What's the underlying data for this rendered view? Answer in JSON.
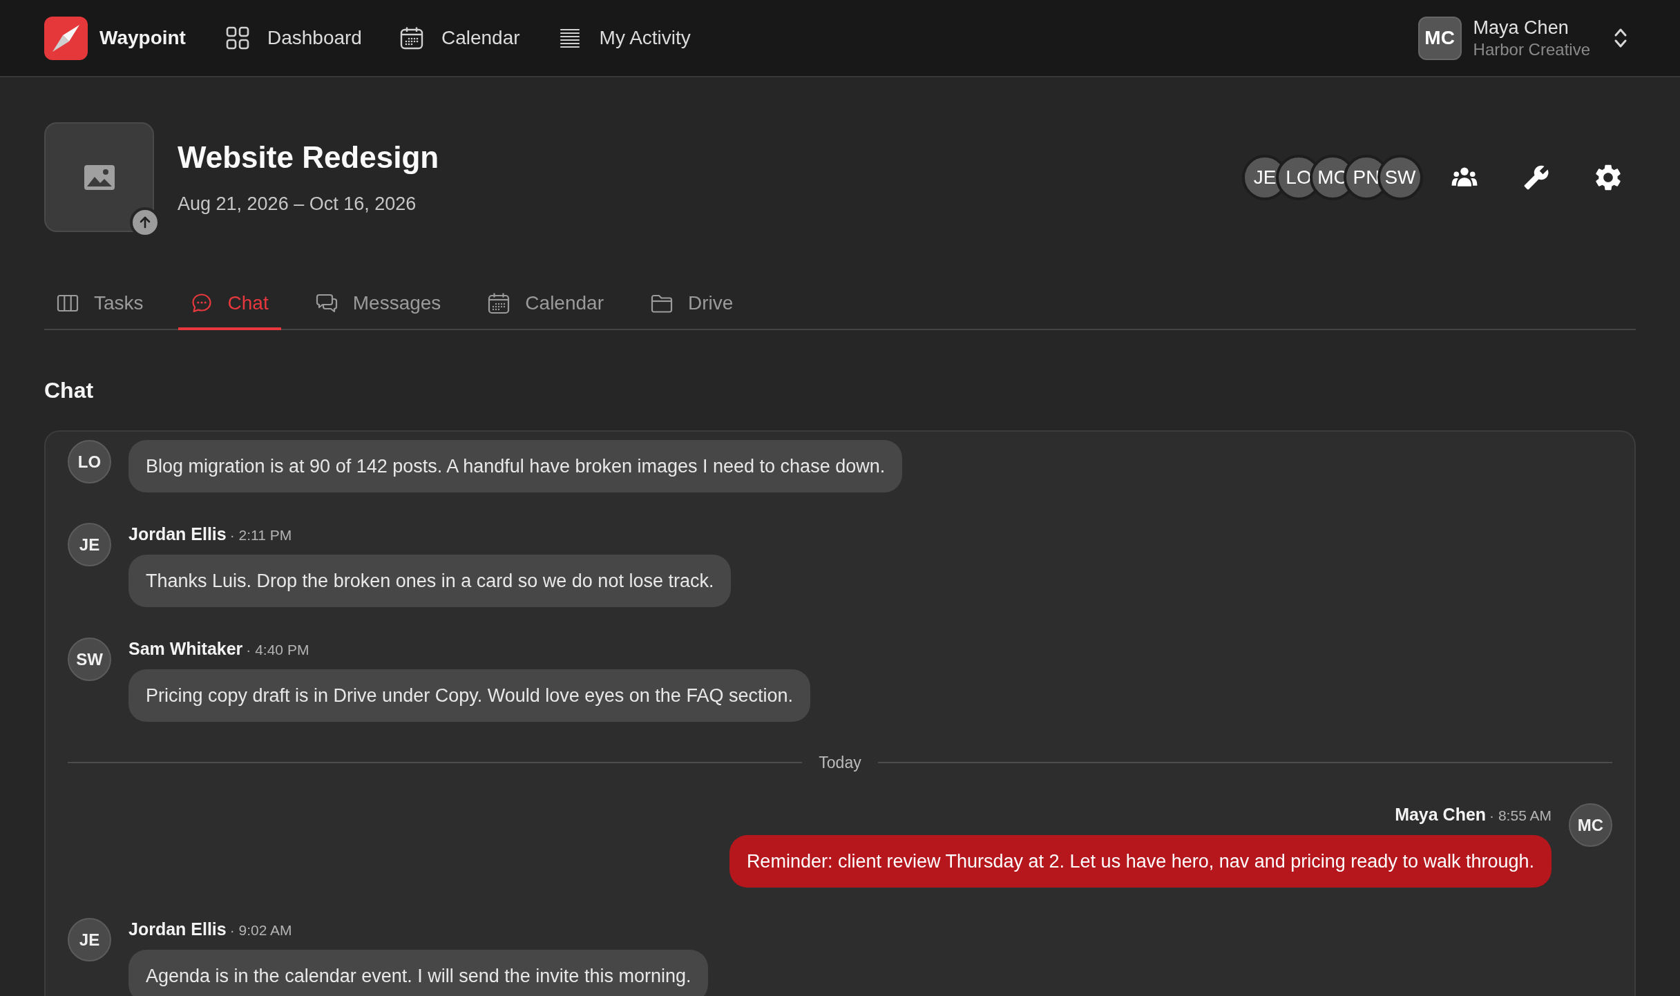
{
  "nav": {
    "brand": "Waypoint",
    "links": [
      {
        "label": "Dashboard"
      },
      {
        "label": "Calendar"
      },
      {
        "label": "My Activity"
      }
    ],
    "user": {
      "initials": "MC",
      "name": "Maya Chen",
      "org": "Harbor Creative"
    }
  },
  "project": {
    "title": "Website Redesign",
    "dates": "Aug 21, 2026 – Oct 16, 2026",
    "members": [
      "JE",
      "LO",
      "MC",
      "PN",
      "SW"
    ]
  },
  "tabs": [
    {
      "label": "Tasks",
      "selected": false
    },
    {
      "label": "Chat",
      "selected": true
    },
    {
      "label": "Messages",
      "selected": false
    },
    {
      "label": "Calendar",
      "selected": false
    },
    {
      "label": "Drive",
      "selected": false
    }
  ],
  "chat": {
    "title": "Chat",
    "items": [
      {
        "kind": "message",
        "initials": "LO",
        "text": "Blog migration is at 90 of 142 posts. A handful have broken images I need to chase down.",
        "mine": false
      },
      {
        "kind": "message",
        "initials": "JE",
        "author": "Jordan Ellis",
        "time": "· 2:11 PM",
        "text": "Thanks Luis. Drop the broken ones in a card so we do not lose track.",
        "mine": false
      },
      {
        "kind": "message",
        "initials": "SW",
        "author": "Sam Whitaker",
        "time": "· 4:40 PM",
        "text": "Pricing copy draft is in Drive under Copy. Would love eyes on the FAQ section.",
        "mine": false
      },
      {
        "kind": "divider",
        "label": "Today"
      },
      {
        "kind": "message",
        "initials": "MC",
        "author": "Maya Chen",
        "time": "· 8:55 AM",
        "text": "Reminder: client review Thursday at 2. Let us have hero, nav and pricing ready to walk through.",
        "mine": true
      },
      {
        "kind": "message",
        "initials": "JE",
        "author": "Jordan Ellis",
        "time": "· 9:02 AM",
        "text": "Agenda is in the calendar event. I will send the invite this morning.",
        "mine": false
      }
    ]
  }
}
